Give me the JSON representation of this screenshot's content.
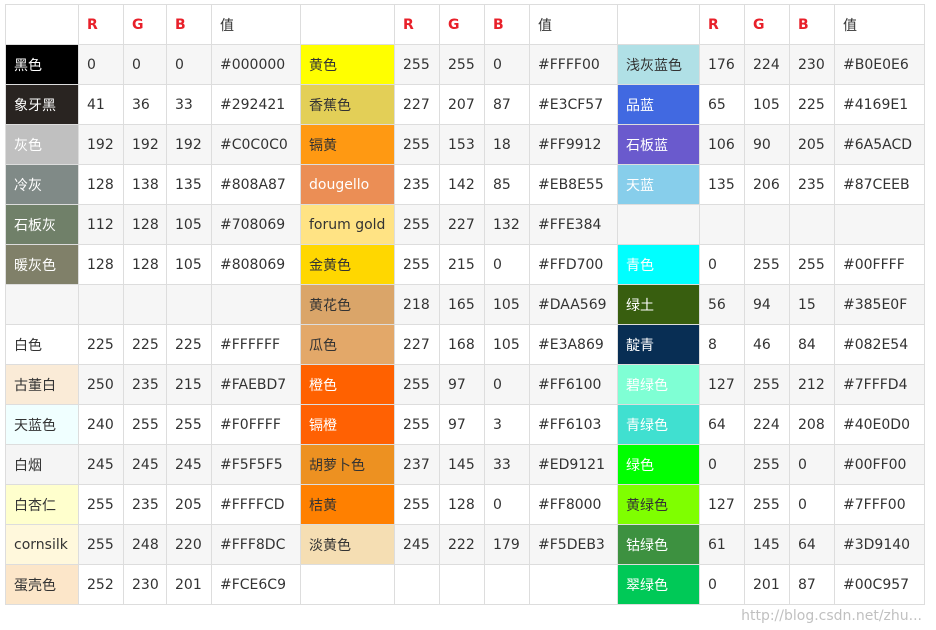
{
  "headers": {
    "r": "R",
    "g": "G",
    "b": "B",
    "hex": "值"
  },
  "rows": [
    [
      {
        "name": "黑色",
        "bg": "#000000",
        "dark": true,
        "r": "0",
        "g": "0",
        "b": "0",
        "hex": "#000000"
      },
      {
        "name": "黄色",
        "bg": "#FFFF00",
        "dark": false,
        "r": "255",
        "g": "255",
        "b": "0",
        "hex": "#FFFF00"
      },
      {
        "name": "浅灰蓝色",
        "bg": "#B0E0E6",
        "dark": false,
        "r": "176",
        "g": "224",
        "b": "230",
        "hex": "#B0E0E6"
      }
    ],
    [
      {
        "name": "象牙黑",
        "bg": "#292421",
        "dark": true,
        "r": "41",
        "g": "36",
        "b": "33",
        "hex": "#292421"
      },
      {
        "name": "香蕉色",
        "bg": "#E3CF57",
        "dark": false,
        "r": "227",
        "g": "207",
        "b": "87",
        "hex": "#E3CF57"
      },
      {
        "name": "品蓝",
        "bg": "#4169E1",
        "dark": true,
        "r": "65",
        "g": "105",
        "b": "225",
        "hex": "#4169E1"
      }
    ],
    [
      {
        "name": "灰色",
        "bg": "#C0C0C0",
        "dark": true,
        "r": "192",
        "g": "192",
        "b": "192",
        "hex": "#C0C0C0"
      },
      {
        "name": "镉黄",
        "bg": "#FF9912",
        "dark": false,
        "r": "255",
        "g": "153",
        "b": "18",
        "hex": "#FF9912"
      },
      {
        "name": "石板蓝",
        "bg": "#6A5ACD",
        "dark": true,
        "r": "106",
        "g": "90",
        "b": "205",
        "hex": "#6A5ACD"
      }
    ],
    [
      {
        "name": "冷灰",
        "bg": "#808A87",
        "dark": true,
        "r": "128",
        "g": "138",
        "b": "135",
        "hex": "#808A87"
      },
      {
        "name": "dougello",
        "bg": "#EB8E55",
        "dark": true,
        "r": "235",
        "g": "142",
        "b": "85",
        "hex": "#EB8E55"
      },
      {
        "name": "天蓝",
        "bg": "#87CEEB",
        "dark": true,
        "r": "135",
        "g": "206",
        "b": "235",
        "hex": "#87CEEB"
      }
    ],
    [
      {
        "name": "石板灰",
        "bg": "#708069",
        "dark": true,
        "r": "112",
        "g": "128",
        "b": "105",
        "hex": "#708069"
      },
      {
        "name": "forum gold",
        "bg": "#FFE384",
        "dark": false,
        "r": "255",
        "g": "227",
        "b": "132",
        "hex": "#FFE384"
      },
      {
        "name": "",
        "bg": "",
        "dark": false,
        "r": "",
        "g": "",
        "b": "",
        "hex": ""
      }
    ],
    [
      {
        "name": "暖灰色",
        "bg": "#808069",
        "dark": true,
        "r": "128",
        "g": "128",
        "b": "105",
        "hex": "#808069"
      },
      {
        "name": "金黄色",
        "bg": "#FFD700",
        "dark": false,
        "r": "255",
        "g": "215",
        "b": "0",
        "hex": "#FFD700"
      },
      {
        "name": "青色",
        "bg": "#00FFFF",
        "dark": true,
        "r": "0",
        "g": "255",
        "b": "255",
        "hex": "#00FFFF"
      }
    ],
    [
      {
        "name": "",
        "bg": "",
        "dark": false,
        "r": "",
        "g": "",
        "b": "",
        "hex": ""
      },
      {
        "name": "黄花色",
        "bg": "#DAA569",
        "dark": false,
        "r": "218",
        "g": "165",
        "b": "105",
        "hex": "#DAA569"
      },
      {
        "name": "绿土",
        "bg": "#385E0F",
        "dark": true,
        "r": "56",
        "g": "94",
        "b": "15",
        "hex": "#385E0F"
      }
    ],
    [
      {
        "name": "白色",
        "bg": "#FFFFFF",
        "dark": false,
        "r": "225",
        "g": "225",
        "b": "225",
        "hex": "#FFFFFF"
      },
      {
        "name": "瓜色",
        "bg": "#E3A869",
        "dark": false,
        "r": "227",
        "g": "168",
        "b": "105",
        "hex": "#E3A869"
      },
      {
        "name": "靛青",
        "bg": "#082E54",
        "dark": true,
        "r": "8",
        "g": "46",
        "b": "84",
        "hex": "#082E54"
      }
    ],
    [
      {
        "name": "古董白",
        "bg": "#FAEBD7",
        "dark": false,
        "r": "250",
        "g": "235",
        "b": "215",
        "hex": "#FAEBD7"
      },
      {
        "name": "橙色",
        "bg": "#FF6100",
        "dark": true,
        "r": "255",
        "g": "97",
        "b": "0",
        "hex": "#FF6100"
      },
      {
        "name": "碧绿色",
        "bg": "#7FFFD4",
        "dark": true,
        "r": "127",
        "g": "255",
        "b": "212",
        "hex": "#7FFFD4"
      }
    ],
    [
      {
        "name": "天蓝色",
        "bg": "#F0FFFF",
        "dark": false,
        "r": "240",
        "g": "255",
        "b": "255",
        "hex": "#F0FFFF"
      },
      {
        "name": "镉橙",
        "bg": "#FF6103",
        "dark": true,
        "r": "255",
        "g": "97",
        "b": "3",
        "hex": "#FF6103"
      },
      {
        "name": "青绿色",
        "bg": "#40E0D0",
        "dark": true,
        "r": "64",
        "g": "224",
        "b": "208",
        "hex": "#40E0D0"
      }
    ],
    [
      {
        "name": "白烟",
        "bg": "#F5F5F5",
        "dark": false,
        "r": "245",
        "g": "245",
        "b": "245",
        "hex": "#F5F5F5"
      },
      {
        "name": "胡萝卜色",
        "bg": "#ED9121",
        "dark": false,
        "r": "237",
        "g": "145",
        "b": "33",
        "hex": "#ED9121"
      },
      {
        "name": "绿色",
        "bg": "#00FF00",
        "dark": true,
        "r": "0",
        "g": "255",
        "b": "0",
        "hex": "#00FF00"
      }
    ],
    [
      {
        "name": "白杏仁",
        "bg": "#FFFFCD",
        "dark": false,
        "r": "255",
        "g": "235",
        "b": "205",
        "hex": "#FFFFCD"
      },
      {
        "name": "桔黄",
        "bg": "#FF8000",
        "dark": false,
        "r": "255",
        "g": "128",
        "b": "0",
        "hex": "#FF8000"
      },
      {
        "name": "黄绿色",
        "bg": "#7FFF00",
        "dark": false,
        "r": "127",
        "g": "255",
        "b": "0",
        "hex": "#7FFF00"
      }
    ],
    [
      {
        "name": "cornsilk",
        "bg": "#FFF8DC",
        "dark": false,
        "r": "255",
        "g": "248",
        "b": "220",
        "hex": "#FFF8DC"
      },
      {
        "name": "淡黄色",
        "bg": "#F5DEB3",
        "dark": false,
        "r": "245",
        "g": "222",
        "b": "179",
        "hex": "#F5DEB3"
      },
      {
        "name": "钴绿色",
        "bg": "#3D9140",
        "dark": true,
        "r": "61",
        "g": "145",
        "b": "64",
        "hex": "#3D9140"
      }
    ],
    [
      {
        "name": "蛋壳色",
        "bg": "#FCE6C9",
        "dark": false,
        "r": "252",
        "g": "230",
        "b": "201",
        "hex": "#FCE6C9"
      },
      {
        "name": "",
        "bg": "",
        "dark": false,
        "r": "",
        "g": "",
        "b": "",
        "hex": ""
      },
      {
        "name": "翠绿色",
        "bg": "#00C957",
        "dark": true,
        "r": "0",
        "g": "201",
        "b": "87",
        "hex": "#00C957"
      }
    ]
  ],
  "watermark": "http://blog.csdn.net/zhu..."
}
